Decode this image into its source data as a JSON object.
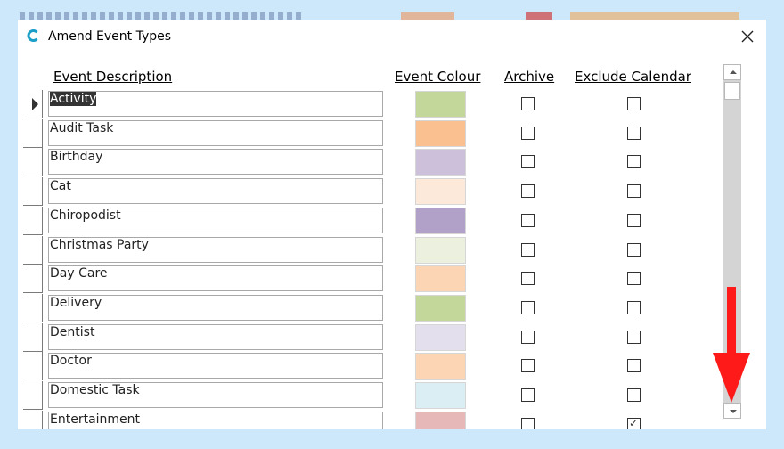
{
  "window": {
    "title": "Amend Event Types",
    "close_icon": "close-icon",
    "app_icon": "app-logo-icon"
  },
  "columns": {
    "description": "Event Description",
    "colour": "Event Colour",
    "archive": "Archive",
    "exclude": "Exclude Calendar"
  },
  "colors": {
    "row_selected_bg": "#333333",
    "annotation_arrow": "#ff0000",
    "page_background": "#cce8fa"
  },
  "rows": [
    {
      "description": "Activity",
      "colour": "#c4d79b",
      "archive": false,
      "exclude": false,
      "current": true
    },
    {
      "description": "Audit Task",
      "colour": "#fac090",
      "archive": false,
      "exclude": false
    },
    {
      "description": "Birthday",
      "colour": "#ccc0da",
      "archive": false,
      "exclude": false
    },
    {
      "description": "Cat",
      "colour": "#fde9d9",
      "archive": false,
      "exclude": false
    },
    {
      "description": "Chiropodist",
      "colour": "#b1a0c7",
      "archive": false,
      "exclude": false
    },
    {
      "description": "Christmas Party",
      "colour": "#ebf1de",
      "archive": false,
      "exclude": false
    },
    {
      "description": "Day Care",
      "colour": "#fcd5b4",
      "archive": false,
      "exclude": false
    },
    {
      "description": "Delivery",
      "colour": "#c4d79b",
      "archive": false,
      "exclude": false
    },
    {
      "description": "Dentist",
      "colour": "#e4dfec",
      "archive": false,
      "exclude": false
    },
    {
      "description": "Doctor",
      "colour": "#fcd5b4",
      "archive": false,
      "exclude": false
    },
    {
      "description": "Domestic Task",
      "colour": "#daeef3",
      "archive": false,
      "exclude": false
    },
    {
      "description": "Entertainment",
      "colour": "#e6b8b7",
      "archive": false,
      "exclude": true
    }
  ]
}
